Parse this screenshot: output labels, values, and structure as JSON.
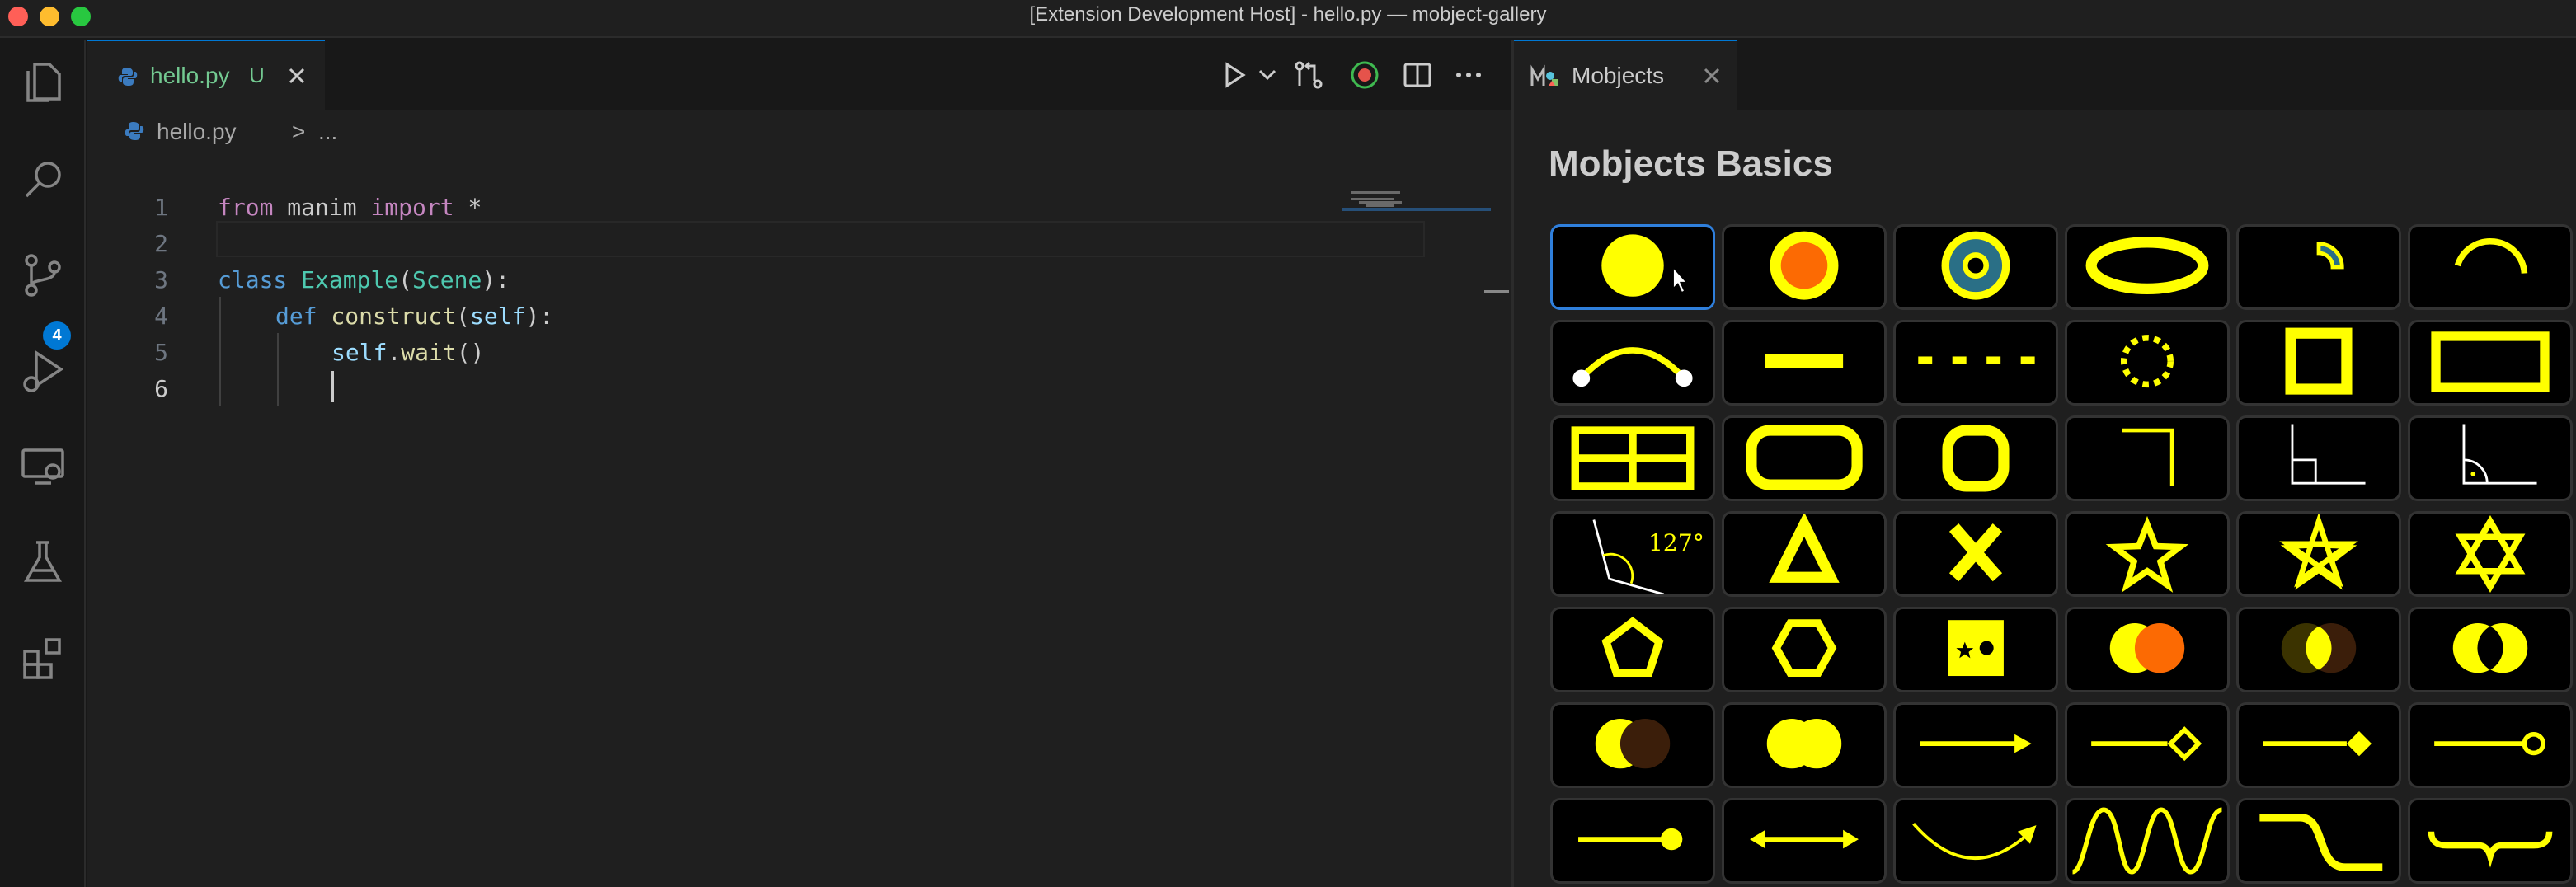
{
  "window": {
    "title": "[Extension Development Host] - hello.py — mobject-gallery"
  },
  "activity_bar": {
    "items": [
      {
        "name": "explorer",
        "icon": "files-icon"
      },
      {
        "name": "search",
        "icon": "search-icon"
      },
      {
        "name": "source-control",
        "icon": "source-control-icon",
        "badge": "4"
      },
      {
        "name": "run-and-debug",
        "icon": "run-debug-icon"
      },
      {
        "name": "remote-explorer",
        "icon": "remote-explorer-icon"
      },
      {
        "name": "testing",
        "icon": "flask-icon"
      },
      {
        "name": "extensions",
        "icon": "extensions-icon"
      }
    ]
  },
  "editor": {
    "tab": {
      "label": "hello.py",
      "status": "U"
    },
    "breadcrumb": {
      "file": "hello.py",
      "separator": ">",
      "more": "..."
    },
    "lines": [
      {
        "number": "1"
      },
      {
        "number": "2"
      },
      {
        "number": "3"
      },
      {
        "number": "4"
      },
      {
        "number": "5"
      },
      {
        "number": "6"
      }
    ],
    "code": {
      "l1_from": "from",
      "l1_module": " manim ",
      "l1_import": "import",
      "l1_star": " *",
      "l3_class": "class",
      "l3_name": " Example",
      "l3_paren_open": "(",
      "l3_base": "Scene",
      "l3_paren_close": "):",
      "l4_def": "def",
      "l4_fn": " construct",
      "l4_paren_open": "(",
      "l4_self": "self",
      "l4_paren_close": "):",
      "l5_self": "self",
      "l5_dot": ".",
      "l5_fn": "wait",
      "l5_call": "()"
    },
    "active_line": "6"
  },
  "panel": {
    "tab": {
      "label": "Mobjects"
    },
    "title": "Mobjects Basics",
    "angle_label": "127°",
    "accent": "#ffff00",
    "secondary": "#fc6a03",
    "teal": "#2a6f86",
    "selected_index": 0,
    "gallery": [
      "dot",
      "annulus-orange",
      "annulus-teal",
      "ellipse",
      "annular-sector",
      "arc",
      "arc-between-points",
      "line",
      "dashed-line",
      "dashed-circle",
      "square",
      "rectangle",
      "table",
      "rounded-rectangle",
      "rounded-square",
      "corner",
      "right-angle",
      "right-angle-dot",
      "angle",
      "triangle",
      "cross",
      "star",
      "star-outline",
      "star-of-david",
      "pentagon",
      "hexagon",
      "cutout",
      "union",
      "intersection",
      "difference",
      "exclusion",
      "double-dot",
      "arrow",
      "arrow-diamond-tip",
      "arrow-square-tip",
      "arrow-circle-tip",
      "line-dot-tip",
      "double-arrow",
      "curved-arrow",
      "sine-wave",
      "s-curve",
      "brace"
    ]
  }
}
